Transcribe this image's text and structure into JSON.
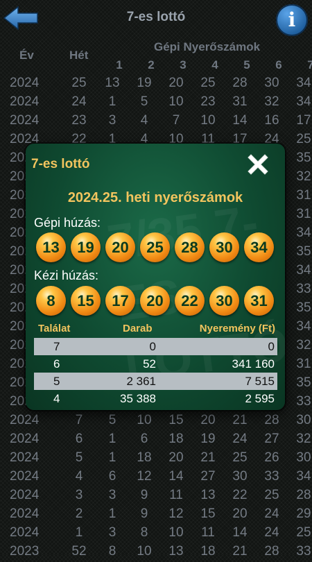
{
  "header": {
    "title": "7-es lottó"
  },
  "background_table": {
    "col_year": "Év",
    "col_week": "Hét",
    "col_machine": "Gépi Nyerőszámok",
    "col_numbers": [
      "1",
      "2",
      "3",
      "4",
      "5",
      "6",
      "7"
    ],
    "rows": [
      {
        "year": "2024",
        "week": "25",
        "nums": [
          "13",
          "19",
          "20",
          "25",
          "28",
          "30",
          "34"
        ]
      },
      {
        "year": "2024",
        "week": "24",
        "nums": [
          "1",
          "5",
          "10",
          "23",
          "31",
          "32",
          "34"
        ]
      },
      {
        "year": "2024",
        "week": "23",
        "nums": [
          "3",
          "4",
          "7",
          "10",
          "14",
          "16",
          "17"
        ]
      },
      {
        "year": "2024",
        "week": "22",
        "nums": [
          "1",
          "4",
          "10",
          "11",
          "17",
          "24",
          "25"
        ]
      },
      {
        "year": "2024",
        "week": "21",
        "nums": [
          "",
          "",
          "",
          "",
          "",
          "",
          "35"
        ]
      },
      {
        "year": "2024",
        "week": "20",
        "nums": [
          "",
          "",
          "",
          "",
          "",
          "",
          "32"
        ]
      },
      {
        "year": "2024",
        "week": "19",
        "nums": [
          "",
          "",
          "",
          "",
          "",
          "",
          "31"
        ]
      },
      {
        "year": "2024",
        "week": "18",
        "nums": [
          "",
          "",
          "",
          "",
          "",
          "",
          "31"
        ]
      },
      {
        "year": "2024",
        "week": "17",
        "nums": [
          "",
          "",
          "",
          "",
          "",
          "",
          "34"
        ]
      },
      {
        "year": "2024",
        "week": "16",
        "nums": [
          "",
          "",
          "",
          "",
          "",
          "",
          "35"
        ]
      },
      {
        "year": "2024",
        "week": "15",
        "nums": [
          "",
          "",
          "",
          "",
          "",
          "",
          "34"
        ]
      },
      {
        "year": "2024",
        "week": "14",
        "nums": [
          "",
          "",
          "",
          "",
          "",
          "",
          "33"
        ]
      },
      {
        "year": "2024",
        "week": "13",
        "nums": [
          "",
          "",
          "",
          "",
          "",
          "",
          "35"
        ]
      },
      {
        "year": "2024",
        "week": "12",
        "nums": [
          "",
          "",
          "",
          "",
          "",
          "",
          "34"
        ]
      },
      {
        "year": "2024",
        "week": "11",
        "nums": [
          "",
          "",
          "",
          "",
          "",
          "",
          "32"
        ]
      },
      {
        "year": "2024",
        "week": "10",
        "nums": [
          "",
          "",
          "",
          "",
          "",
          "",
          "31"
        ]
      },
      {
        "year": "2024",
        "week": "9",
        "nums": [
          "",
          "",
          "",
          "",
          "",
          "",
          "35"
        ]
      },
      {
        "year": "2024",
        "week": "8",
        "nums": [
          "",
          "",
          "",
          "",
          "",
          "",
          "33"
        ]
      },
      {
        "year": "2024",
        "week": "7",
        "nums": [
          "5",
          "10",
          "15",
          "20",
          "21",
          "28",
          "30"
        ]
      },
      {
        "year": "2024",
        "week": "6",
        "nums": [
          "1",
          "6",
          "18",
          "19",
          "24",
          "27",
          "32"
        ]
      },
      {
        "year": "2024",
        "week": "5",
        "nums": [
          "1",
          "18",
          "20",
          "21",
          "25",
          "26",
          "30"
        ]
      },
      {
        "year": "2024",
        "week": "4",
        "nums": [
          "6",
          "12",
          "14",
          "27",
          "30",
          "33",
          "34"
        ]
      },
      {
        "year": "2024",
        "week": "3",
        "nums": [
          "3",
          "9",
          "11",
          "13",
          "22",
          "25",
          "28"
        ]
      },
      {
        "year": "2024",
        "week": "2",
        "nums": [
          "1",
          "9",
          "12",
          "15",
          "20",
          "24",
          "29"
        ]
      },
      {
        "year": "2024",
        "week": "1",
        "nums": [
          "3",
          "8",
          "10",
          "11",
          "14",
          "24",
          "25"
        ]
      },
      {
        "year": "2023",
        "week": "52",
        "nums": [
          "8",
          "10",
          "13",
          "18",
          "21",
          "28",
          "33"
        ]
      }
    ]
  },
  "dialog": {
    "title": "7-es lottó",
    "week_title": "2024.25. heti nyerőszámok",
    "machine_label": "Gépi húzás:",
    "machine_numbers": [
      "13",
      "19",
      "20",
      "25",
      "28",
      "30",
      "34"
    ],
    "manual_label": "Kézi húzás:",
    "manual_numbers": [
      "8",
      "15",
      "17",
      "20",
      "22",
      "30",
      "31"
    ],
    "watermark": "7/35 7-ES LOTTÓ",
    "prize_headers": {
      "match": "Találat",
      "count": "Darab",
      "prize": "Nyeremény (Ft)"
    },
    "prize_rows": [
      {
        "match": "7",
        "count": "0",
        "prize": "0"
      },
      {
        "match": "6",
        "count": "52",
        "prize": "341 160"
      },
      {
        "match": "5",
        "count": "2 361",
        "prize": "7 515"
      },
      {
        "match": "4",
        "count": "35 388",
        "prize": "2 595"
      }
    ]
  },
  "icons": {
    "back": "back-arrow-icon",
    "info": "info-icon",
    "close": "close-icon"
  },
  "colors": {
    "accent": "#f2c45e",
    "dialog_bg": "#0f4a31",
    "ball": "#f08a14",
    "info": "#2a72b8"
  }
}
